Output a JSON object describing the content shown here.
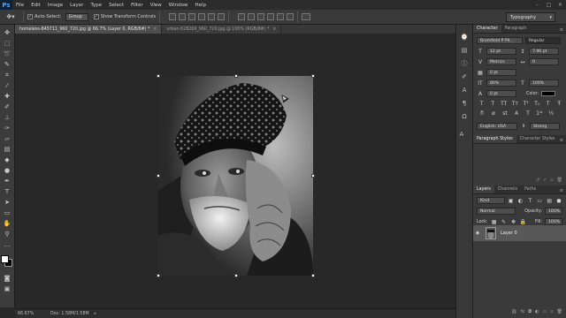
{
  "menubar": {
    "logo": "Ps",
    "items": [
      "File",
      "Edit",
      "Image",
      "Layer",
      "Type",
      "Select",
      "Filter",
      "View",
      "Window",
      "Help"
    ],
    "window_controls": [
      "–",
      "□",
      "✕"
    ]
  },
  "options": {
    "auto_select_label": "Auto-Select:",
    "auto_select_value": "Group",
    "show_transform_label": "Show Transform Controls",
    "workspace": "Typography"
  },
  "tabs": [
    {
      "label": "homeless-845711_960_720.jpg @ 66.7% (Layer 0, RGB/8#) *",
      "close": "×"
    },
    {
      "label": "urban-628269_960_720.jpg @ 100% (RGB/8#) *",
      "close": "×"
    }
  ],
  "status": {
    "zoom": "66.67%",
    "doc": "Doc: 1.58M/1.58M",
    "arrow": "▸"
  },
  "character": {
    "tabs": [
      "Character",
      "Paragraph"
    ],
    "font_family": "Bromfield P Pll...",
    "font_style": "Regular",
    "font_size": "12 pt",
    "leading": "7.96 pt",
    "kerning": "Metrics",
    "tracking": "0",
    "baseline": "0 pt",
    "vertical_scale": "80%",
    "horizontal_scale": "100%",
    "color_label": "Color:",
    "language": "English: USA",
    "anti_alias": "Strong"
  },
  "styles": {
    "tabs": [
      "Paragraph Styles",
      "Character Styles"
    ]
  },
  "layers": {
    "tabs": [
      "Layers",
      "Channels",
      "Paths"
    ],
    "kind": "Kind",
    "blend_mode": "Normal",
    "opacity_label": "Opacity:",
    "opacity_value": "100%",
    "lock_label": "Lock:",
    "fill_label": "Fill:",
    "fill_value": "100%",
    "layer_name": "Layer 0"
  },
  "colors": {
    "menubar": "#2b2b2b",
    "optionsbar": "#3a3a3a",
    "canvas": "#282828",
    "panel": "#3a3a3a",
    "accent_ps": "#47a4ff"
  }
}
